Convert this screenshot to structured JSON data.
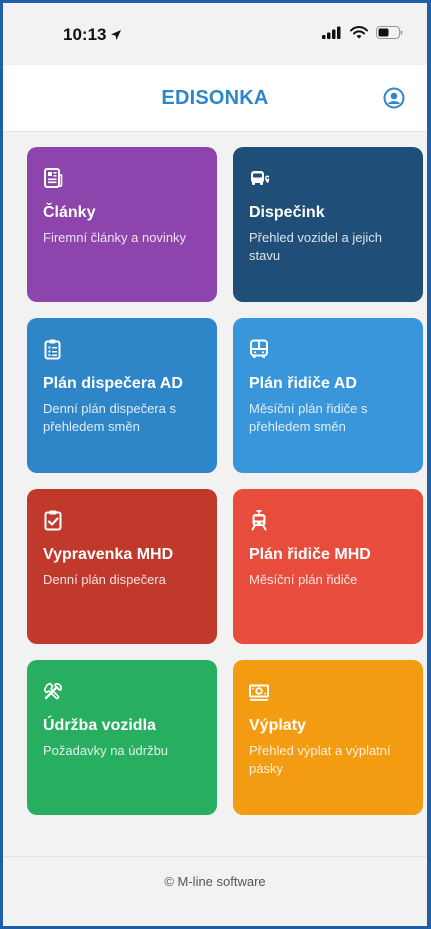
{
  "status_bar": {
    "time": "10:13"
  },
  "header": {
    "title": "EDISONKA"
  },
  "cards": [
    {
      "title": "Články",
      "subtitle": "Firemní články a novinky",
      "color": "#8e44ad",
      "icon": "newspaper-icon"
    },
    {
      "title": "Dispečink",
      "subtitle": "Přehled vozidel a jejich stavu",
      "color": "#1f4e79",
      "icon": "bus-location-icon"
    },
    {
      "title": "Plán dispečera AD",
      "subtitle": "Denní plán dispečera s přehledem směn",
      "color": "#2e86c9",
      "icon": "clipboard-list-icon"
    },
    {
      "title": "Plán řidiče AD",
      "subtitle": "Měsíční plán řidiče s přehledem směn",
      "color": "#3a96db",
      "icon": "bus-icon"
    },
    {
      "title": "Vypravenka MHD",
      "subtitle": "Denní plán dispečera",
      "color": "#c0392b",
      "icon": "clipboard-check-icon"
    },
    {
      "title": "Plán řidiče MHD",
      "subtitle": "Měsíční plán řidiče",
      "color": "#e74c3c",
      "icon": "tram-icon"
    },
    {
      "title": "Údržba vozidla",
      "subtitle": "Požadavky na údržbu",
      "color": "#27ae60",
      "icon": "tools-icon"
    },
    {
      "title": "Výplaty",
      "subtitle": "Přehled výplat a výplatní pásky",
      "color": "#f39c12",
      "icon": "money-bill-icon"
    }
  ],
  "footer": {
    "text": "© M-line software"
  }
}
